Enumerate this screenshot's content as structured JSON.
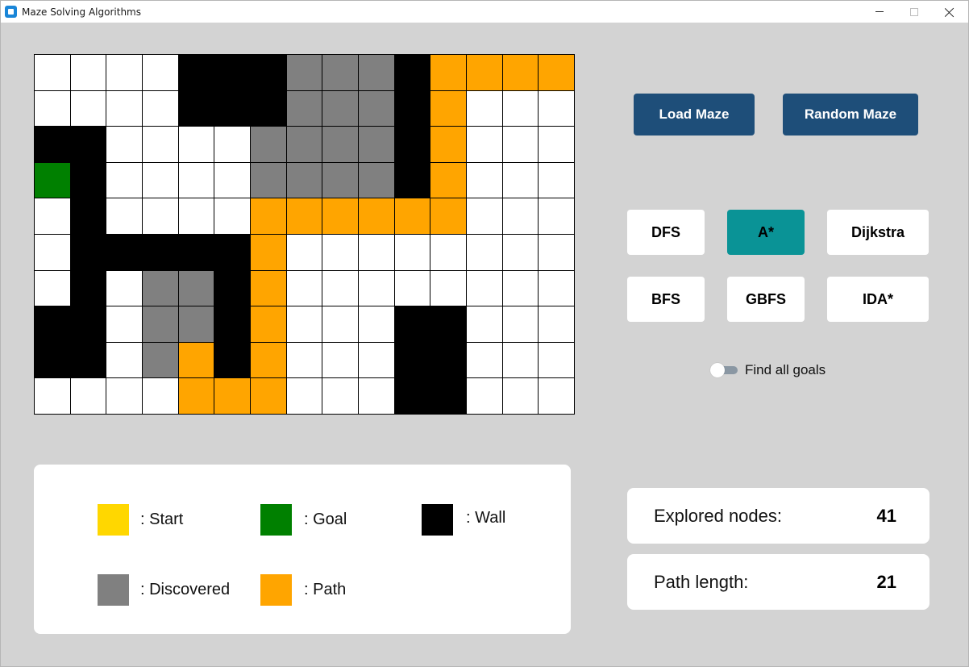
{
  "window": {
    "title": "Maze Solving Algorithms"
  },
  "maze": {
    "rows": 10,
    "cols": 15,
    "legend_codes": {
      "0": "open",
      "1": "wall",
      "2": "discovered",
      "3": "path",
      "4": "goal",
      "5": "start"
    },
    "grid": [
      [
        0,
        0,
        0,
        0,
        1,
        1,
        1,
        2,
        2,
        2,
        1,
        3,
        3,
        3,
        3
      ],
      [
        0,
        0,
        0,
        0,
        1,
        1,
        1,
        2,
        2,
        2,
        1,
        3,
        0,
        0,
        0
      ],
      [
        1,
        1,
        0,
        0,
        0,
        0,
        2,
        2,
        2,
        2,
        1,
        3,
        0,
        0,
        0
      ],
      [
        4,
        1,
        0,
        0,
        0,
        0,
        2,
        2,
        2,
        2,
        1,
        3,
        0,
        0,
        0
      ],
      [
        0,
        1,
        0,
        0,
        0,
        0,
        3,
        3,
        3,
        3,
        3,
        3,
        0,
        0,
        0
      ],
      [
        0,
        1,
        1,
        1,
        1,
        1,
        3,
        0,
        0,
        0,
        0,
        0,
        0,
        0,
        0
      ],
      [
        0,
        1,
        0,
        2,
        2,
        1,
        3,
        0,
        0,
        0,
        0,
        0,
        0,
        0,
        0
      ],
      [
        1,
        1,
        0,
        2,
        2,
        1,
        3,
        0,
        0,
        0,
        1,
        1,
        0,
        0,
        0
      ],
      [
        1,
        1,
        0,
        2,
        3,
        1,
        3,
        0,
        0,
        0,
        1,
        1,
        0,
        0,
        0
      ],
      [
        0,
        0,
        0,
        0,
        3,
        3,
        3,
        0,
        0,
        0,
        1,
        1,
        0,
        0,
        0
      ]
    ]
  },
  "controls": {
    "load_label": "Load Maze",
    "random_label": "Random Maze",
    "algorithms": [
      "DFS",
      "A*",
      "Dijkstra",
      "BFS",
      "GBFS",
      "IDA*"
    ],
    "selected_algorithm": "A*",
    "find_all_goals_label": "Find all goals",
    "find_all_goals_enabled": false
  },
  "legend": {
    "start": ": Start",
    "goal": ": Goal",
    "wall": ": Wall",
    "discovered": ": Discovered",
    "path": ": Path"
  },
  "stats": {
    "explored_label": "Explored nodes:",
    "explored_value": "41",
    "path_label": "Path length:",
    "path_value": "21"
  },
  "colors": {
    "open": "#ffffff",
    "wall": "#000000",
    "discovered": "#808080",
    "path": "#ffa500",
    "goal": "#008000",
    "start": "#ffd700",
    "button_dark": "#1e4e79",
    "button_active": "#0a9396",
    "background": "#d3d3d3"
  },
  "icons": {
    "app": "app-window-icon",
    "minimize": "minimize-icon",
    "maximize": "maximize-icon",
    "close": "close-icon"
  }
}
